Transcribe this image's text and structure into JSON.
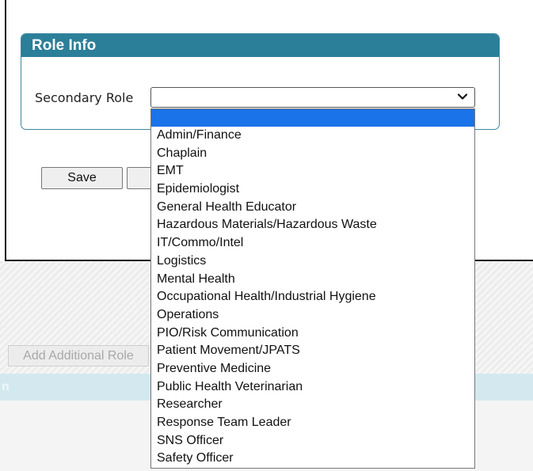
{
  "role_info": {
    "title": "Role Info",
    "secondary_role_label": "Secondary Role",
    "secondary_role_value": ""
  },
  "buttons": {
    "save": "Save"
  },
  "background": {
    "add_role_button": "Add Additional Role",
    "band_text": "n"
  },
  "dropdown_options": [
    "",
    "Admin/Finance",
    "Chaplain",
    "EMT",
    "Epidemiologist",
    "General Health Educator",
    "Hazardous Materials/Hazardous Waste",
    "IT/Commo/Intel",
    "Logistics",
    "Mental Health",
    "Occupational Health/Industrial Hygiene",
    "Operations",
    "PIO/Risk Communication",
    "Patient Movement/JPATS",
    "Preventive Medicine",
    "Public Health Veterinarian",
    "Researcher",
    "Response Team Leader",
    "SNS Officer",
    "Safety Officer"
  ],
  "colors": {
    "legend_bg": "#2b7f98",
    "selected_option": "#1a73e8"
  }
}
